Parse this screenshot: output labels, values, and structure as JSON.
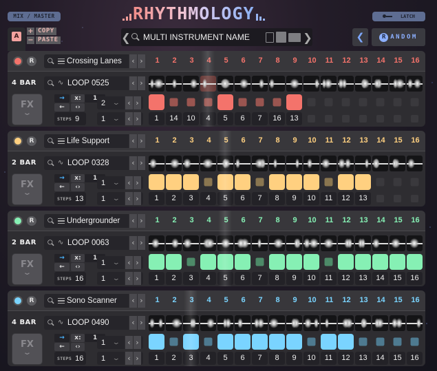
{
  "header": {
    "mix_master": "MIX / MASTER",
    "logo": "RHYTHMOLOGY",
    "latch": "LATCH",
    "slot": "A",
    "copy": "COPY",
    "paste": "PASTE",
    "plus": "+",
    "minus": "−",
    "preset_name": "MULTI INSTRUMENT NAME",
    "prev_chevron": "❮",
    "next_chevron": "❯",
    "random_badge": "R",
    "random_label": "ANDOM",
    "rand_prev": "❮"
  },
  "common": {
    "arrow_left": "‹",
    "arrow_right": "›",
    "fx": "FX",
    "fx_chevron": "⌄",
    "forward": "→",
    "multiplier_label": "x:",
    "backward": "←",
    "pingpong": "‹›",
    "steps_label": "STEPS",
    "wave_symbol": "∿",
    "dropdown_chevron": "⌄"
  },
  "tracks": [
    {
      "name": "Crossing Lanes",
      "color": "#f4736b",
      "dim_color": "#9a5550",
      "bars": "4 BAR",
      "loop": "LOOP 0525",
      "multiplier": "1",
      "steps": "9",
      "select1": "2",
      "select2": "1",
      "playhead_step": 4,
      "step_numbers": [
        "1",
        "2",
        "3",
        "4",
        "5",
        "6",
        "7",
        "8",
        "9",
        "10",
        "11",
        "12",
        "13",
        "14",
        "15",
        "16"
      ],
      "pads": [
        "big",
        "small",
        "small",
        "small",
        "big",
        "small",
        "small",
        "small",
        "big",
        "off",
        "off",
        "off",
        "off",
        "off",
        "off",
        "off"
      ],
      "slices": [
        "1",
        "14",
        "10",
        "4",
        "5",
        "6",
        "7",
        "16",
        "13",
        "",
        "",
        "",
        "",
        "",
        "",
        ""
      ]
    },
    {
      "name": "Life Support",
      "color": "#ffd080",
      "dim_color": "#8a7650",
      "bars": "2 BAR",
      "loop": "LOOP 0328",
      "multiplier": "1",
      "steps": "13",
      "select1": "1",
      "select2": "1",
      "playhead_step": 5,
      "step_numbers": [
        "1",
        "2",
        "3",
        "4",
        "5",
        "6",
        "7",
        "8",
        "9",
        "10",
        "11",
        "12",
        "13",
        "14",
        "15",
        "16"
      ],
      "pads": [
        "big",
        "big",
        "big",
        "small",
        "big",
        "big",
        "small",
        "big",
        "big",
        "big",
        "small",
        "big",
        "big",
        "off",
        "off",
        "off"
      ],
      "slices": [
        "1",
        "2",
        "3",
        "4",
        "5",
        "6",
        "7",
        "8",
        "9",
        "10",
        "11",
        "12",
        "13",
        "",
        "",
        ""
      ]
    },
    {
      "name": "Undergrounder",
      "color": "#86f0b4",
      "dim_color": "#4d8a68",
      "bars": "2 BAR",
      "loop": "LOOP 0063",
      "multiplier": "1",
      "steps": "16",
      "select1": "1",
      "select2": "1",
      "playhead_step": 5,
      "step_numbers": [
        "1",
        "2",
        "3",
        "4",
        "5",
        "6",
        "7",
        "8",
        "9",
        "10",
        "11",
        "12",
        "13",
        "14",
        "15",
        "16"
      ],
      "pads": [
        "big",
        "big",
        "small",
        "big",
        "big",
        "big",
        "small",
        "big",
        "big",
        "big",
        "small",
        "big",
        "big",
        "big",
        "big",
        "big"
      ],
      "slices": [
        "1",
        "2",
        "3",
        "4",
        "5",
        "6",
        "7",
        "8",
        "9",
        "10",
        "11",
        "12",
        "13",
        "14",
        "15",
        "16"
      ]
    },
    {
      "name": "Sono Scanner",
      "color": "#7ad4ff",
      "dim_color": "#4e7a90",
      "bars": "4 BAR",
      "loop": "LOOP 0490",
      "multiplier": "1",
      "steps": "16",
      "select1": "1",
      "select2": "1",
      "playhead_step": 3,
      "step_numbers": [
        "1",
        "2",
        "3",
        "4",
        "5",
        "6",
        "7",
        "8",
        "9",
        "10",
        "11",
        "12",
        "13",
        "14",
        "15",
        "16"
      ],
      "pads": [
        "big",
        "small",
        "big",
        "small",
        "big",
        "big",
        "big",
        "big",
        "big",
        "small",
        "big",
        "big",
        "small",
        "small",
        "small",
        "small"
      ],
      "slices": [
        "1",
        "2",
        "3",
        "4",
        "5",
        "6",
        "7",
        "8",
        "9",
        "10",
        "11",
        "12",
        "13",
        "14",
        "15",
        "16"
      ]
    }
  ]
}
